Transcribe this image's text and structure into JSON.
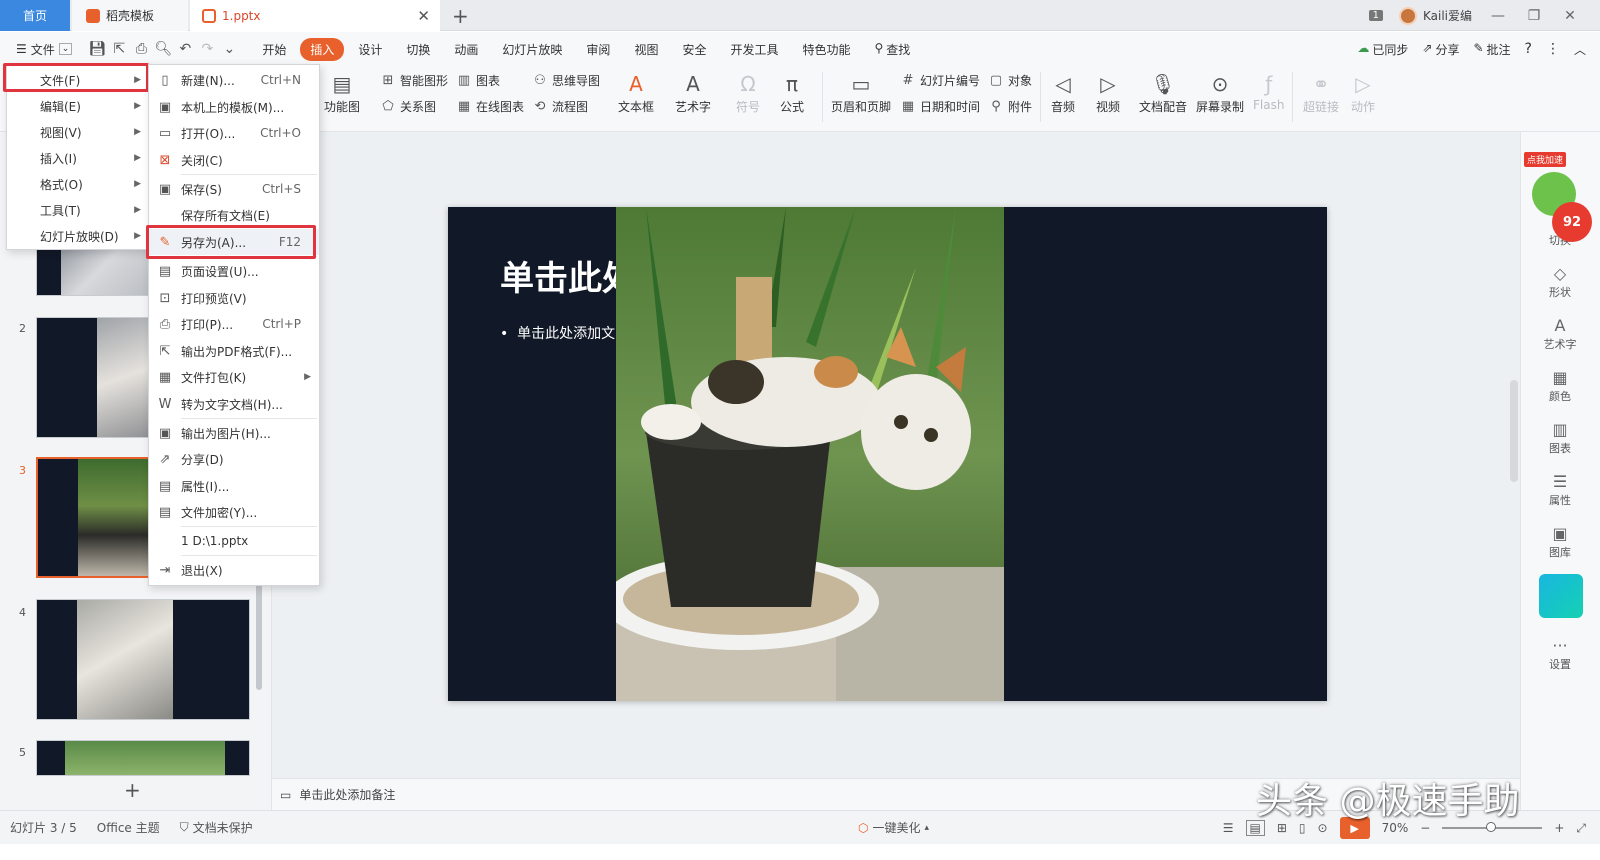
{
  "tabs": {
    "home": "首页",
    "docer": "稻壳模板",
    "file": "1.pptx"
  },
  "titlebar": {
    "page_badge": "1",
    "user": "Kaili爱编"
  },
  "menubar": {
    "file_label": "文件",
    "ribbon_tabs": [
      "开始",
      "插入",
      "设计",
      "切换",
      "动画",
      "幻灯片放映",
      "审阅",
      "视图",
      "安全",
      "开发工具",
      "特色功能"
    ],
    "search": "查找",
    "right": {
      "sync": "已同步",
      "share": "分享",
      "comment": "批注"
    }
  },
  "ribbon": {
    "function_chart": "功能图",
    "smart_art": "智能图形",
    "chart": "图表",
    "relation": "关系图",
    "online_chart": "在线图表",
    "mindmap": "思维导图",
    "flowchart": "流程图",
    "textbox": "文本框",
    "wordart": "艺术字",
    "symbol": "符号",
    "formula": "公式",
    "header_footer": "页眉和页脚",
    "slide_number": "幻灯片编号",
    "object": "对象",
    "datetime": "日期和时间",
    "attachment": "附件",
    "audio": "音频",
    "video": "视频",
    "doc_voice": "文档配音",
    "screen_record": "屏幕录制",
    "flash": "Flash",
    "hyperlink": "超链接",
    "action": "动作"
  },
  "file_menu": {
    "items": [
      {
        "label": "文件(F)"
      },
      {
        "label": "编辑(E)"
      },
      {
        "label": "视图(V)"
      },
      {
        "label": "插入(I)"
      },
      {
        "label": "格式(O)"
      },
      {
        "label": "工具(T)"
      },
      {
        "label": "幻灯片放映(D)"
      }
    ]
  },
  "file_submenu": {
    "new": {
      "label": "新建(N)...",
      "shortcut": "Ctrl+N"
    },
    "local_template": {
      "label": "本机上的模板(M)..."
    },
    "open": {
      "label": "打开(O)...",
      "shortcut": "Ctrl+O"
    },
    "close": {
      "label": "关闭(C)"
    },
    "save": {
      "label": "保存(S)",
      "shortcut": "Ctrl+S"
    },
    "save_all": {
      "label": "保存所有文档(E)"
    },
    "save_as": {
      "label": "另存为(A)...",
      "shortcut": "F12"
    },
    "page_setup": {
      "label": "页面设置(U)..."
    },
    "print_preview": {
      "label": "打印预览(V)"
    },
    "print": {
      "label": "打印(P)...",
      "shortcut": "Ctrl+P"
    },
    "export_pdf": {
      "label": "输出为PDF格式(F)..."
    },
    "pack": {
      "label": "文件打包(K)"
    },
    "to_text": {
      "label": "转为文字文档(H)..."
    },
    "export_image": {
      "label": "输出为图片(H)..."
    },
    "share": {
      "label": "分享(D)"
    },
    "properties": {
      "label": "属性(I)..."
    },
    "encrypt": {
      "label": "文件加密(Y)..."
    },
    "recent": {
      "label": "1 D:\\1.pptx"
    },
    "exit": {
      "label": "退出(X)"
    }
  },
  "slides": {
    "numbers": [
      "2",
      "3",
      "4",
      "5"
    ],
    "current_title": "单击此处",
    "current_bullet": "单击此处添加文"
  },
  "notes": "单击此处添加备注",
  "right_sidebar": [
    "切换",
    "形状",
    "艺术字",
    "颜色",
    "图表",
    "属性",
    "图库",
    "设置"
  ],
  "speed_badge": {
    "label": "点我加速",
    "value": "92"
  },
  "status": {
    "slide_pos": "幻灯片 3 / 5",
    "theme": "Office 主题",
    "protect": "文档未保护",
    "beautify": "一键美化",
    "zoom": "70%"
  },
  "watermark": "头条 @极速手助"
}
